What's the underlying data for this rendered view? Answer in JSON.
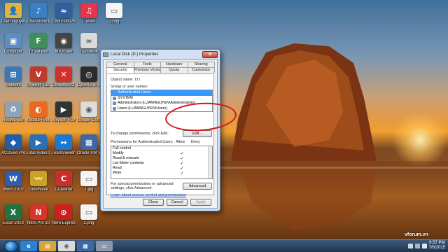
{
  "desktop": {
    "icons": [
      {
        "label": "Luan Nguyen",
        "icon": "user-folder-icon",
        "color": "#e2b33c",
        "glyph": "👤"
      },
      {
        "label": "Total Audio MP3 Conver...",
        "icon": "audio-converter-icon",
        "color": "#3a7fc4",
        "glyph": "♪"
      },
      {
        "label": "Cool Edit Pro 2.1",
        "icon": "cool-edit-icon",
        "color": "#2f5f9e",
        "glyph": "≈"
      },
      {
        "label": "iTunes",
        "icon": "itunes-icon",
        "color": "#e8344a",
        "glyph": "♫"
      },
      {
        "label": "1.png",
        "icon": "png-file-icon",
        "color": "#f4f4f4",
        "glyph": "▭"
      },
      {
        "label": "Computer",
        "icon": "computer-icon",
        "color": "#5d8cc0",
        "glyph": "▣"
      },
      {
        "label": "FFVal.exe",
        "icon": "exe-icon",
        "color": "#3f8f5a",
        "glyph": "F"
      },
      {
        "label": "MP3Gain",
        "icon": "mp3gain-icon",
        "color": "#444444",
        "glyph": "◉"
      },
      {
        "label": "iTiesbook",
        "icon": "itiesbook-icon",
        "color": "#dadada",
        "glyph": "∞"
      },
      {
        "label": "Network",
        "icon": "network-icon",
        "color": "#3b78b6",
        "glyph": "⊞"
      },
      {
        "label": "Unikey4 Gui.exe",
        "icon": "unikey-icon",
        "color": "#c03a2b",
        "glyph": "V"
      },
      {
        "label": "CrowdfleetX...",
        "icon": "crowdfleet-icon",
        "color": "#d0312d",
        "glyph": "✕"
      },
      {
        "label": "CyberLink YouCam",
        "icon": "youcam-icon",
        "color": "#2c2c2c",
        "glyph": "◎"
      },
      {
        "label": "Recycle Bin",
        "icon": "recycle-bin-icon",
        "color": "#8fa3b8",
        "glyph": "♻"
      },
      {
        "label": "Mozilla Firefox",
        "icon": "firefox-icon",
        "color": "#e8691f",
        "glyph": "◐"
      },
      {
        "label": "iSkysoft FLV Converter",
        "icon": "flv-converter-icon",
        "color": "#333333",
        "glyph": "▶"
      },
      {
        "label": "Google Chrome",
        "icon": "chrome-icon",
        "color": "#dddddd",
        "glyph": "◉"
      },
      {
        "label": "ACDSee Pro 5",
        "icon": "acdsee-icon",
        "color": "#1f5fa8",
        "glyph": "◆"
      },
      {
        "label": "Total Video Converter",
        "icon": "video-converter-icon",
        "color": "#2e6fb2",
        "glyph": "▶"
      },
      {
        "label": "TeamViewer 10",
        "icon": "teamviewer-icon",
        "color": "#1b79d4",
        "glyph": "↔"
      },
      {
        "label": "Oracle VM VirtualBox",
        "icon": "virtualbox-icon",
        "color": "#3f67a6",
        "glyph": "▦"
      },
      {
        "label": "Word 2010",
        "icon": "word-icon",
        "color": "#2b5fad",
        "glyph": "W"
      },
      {
        "label": "GoldWave",
        "icon": "goldwave-icon",
        "color": "#c9a227",
        "glyph": "〰"
      },
      {
        "label": "CCleaner",
        "icon": "ccleaner-icon",
        "color": "#cc2e2e",
        "glyph": "C"
      },
      {
        "label": "1.jpg",
        "icon": "jpg-file-icon",
        "color": "#f4f4f4",
        "glyph": "▭"
      },
      {
        "label": "Excel 2010",
        "icon": "excel-icon",
        "color": "#217346",
        "glyph": "X"
      },
      {
        "label": "Nitro Pro 10",
        "icon": "nitro-pro-icon",
        "color": "#d9342b",
        "glyph": "N"
      },
      {
        "label": "Nero Express",
        "icon": "nero-express-icon",
        "color": "#cc1f1f",
        "glyph": "⊙"
      },
      {
        "label": "2.png",
        "icon": "png-file-icon",
        "color": "#f4f4f4",
        "glyph": "▭"
      }
    ]
  },
  "dialog": {
    "title": "Local Disk (D:) Properties",
    "close_glyph": "✕",
    "tabs_row1": [
      "General",
      "Tools",
      "Hardware",
      "Sharing"
    ],
    "tabs_row2": [
      "Security",
      "Previous Versions",
      "Quota",
      "Customize"
    ],
    "active_tab": "Security",
    "object_name_label": "Object name:",
    "object_name_value": "D:\\",
    "group_label": "Group or user names:",
    "groups": [
      "Authenticated Users",
      "SYSTEM",
      "Administrators (LUANNGUYEN\\Administrators)",
      "Users (LUANNGUYEN\\Users)"
    ],
    "change_perm_text": "To change permissions, click Edit.",
    "edit_button": "Edit...",
    "permissions_label": "Permissions for Authenticated Users",
    "allow_header": "Allow",
    "deny_header": "Deny",
    "permissions": [
      {
        "name": "Full control",
        "allow": "",
        "deny": ""
      },
      {
        "name": "Modify",
        "allow": "✓",
        "deny": ""
      },
      {
        "name": "Read & execute",
        "allow": "✓",
        "deny": ""
      },
      {
        "name": "List folder contents",
        "allow": "✓",
        "deny": ""
      },
      {
        "name": "Read",
        "allow": "✓",
        "deny": ""
      },
      {
        "name": "Write",
        "allow": "✓",
        "deny": ""
      }
    ],
    "special_perm_text": "For special permissions or advanced settings, click Advanced.",
    "advanced_button": "Advanced",
    "learn_link": "Learn about access control and permissions",
    "close_button": "Close",
    "cancel_button": "Cancel",
    "apply_button": "Apply"
  },
  "taskbar": {
    "pinned": [
      {
        "icon": "ie-icon",
        "color": "#2f7fd0",
        "glyph": "e"
      },
      {
        "icon": "explorer-icon",
        "color": "#d9a53a",
        "glyph": "▤"
      },
      {
        "icon": "chrome-taskbar-icon",
        "color": "#d9d9d9",
        "glyph": "◉"
      },
      {
        "icon": "virtualbox-taskbar-icon",
        "color": "#3f67a6",
        "glyph": "▦"
      },
      {
        "icon": "drive-properties-taskbar-icon",
        "color": "#8a97a6",
        "glyph": "▭"
      }
    ],
    "clock_time": "9:57 PM",
    "clock_date": "7/6/2015"
  },
  "watermark": "vforum.vn",
  "colors": {
    "highlight": "#d8141a",
    "selection": "#3399ff"
  }
}
